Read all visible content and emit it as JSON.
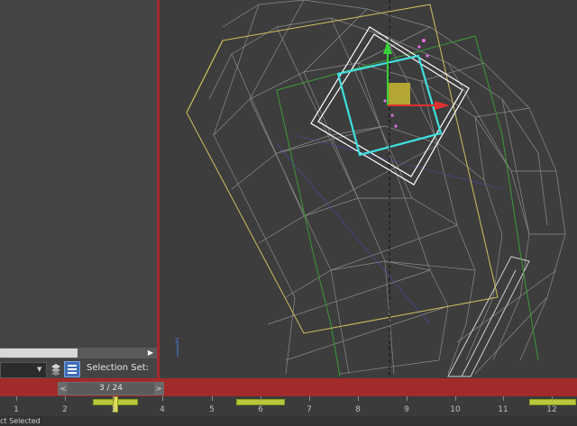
{
  "selection_bar": {
    "label": "Selection Set:"
  },
  "time": {
    "current_frame_label": "3 / 24",
    "prev_arrow": "<",
    "next_arrow": ">",
    "ticks": [
      "1",
      "2",
      "3",
      "4",
      "5",
      "6",
      "7",
      "8",
      "9",
      "10",
      "11",
      "12"
    ]
  },
  "status_bar": {
    "text": "ct Selected"
  },
  "icons": {
    "layers": "layers-icon",
    "selection_set": "selection-set-icon",
    "scroll_right": "chevron-right-icon"
  },
  "colors": {
    "accent_red": "#a32a2a",
    "key_green": "#b7c93a",
    "selection_cyan": "#3fe0e0",
    "gizmo_yellow": "#e8e040"
  }
}
